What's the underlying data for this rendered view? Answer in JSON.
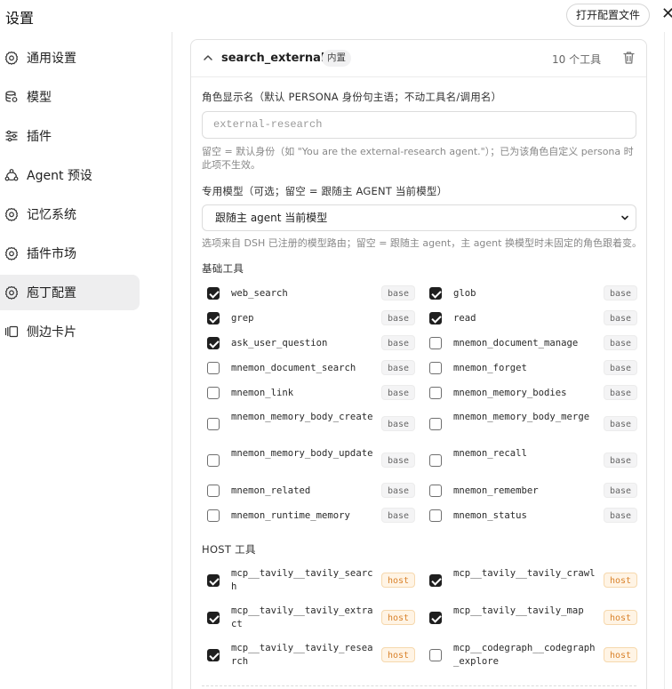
{
  "window": {
    "title": "设置",
    "open_config_label": "打开配置文件",
    "close_glyph": "✕"
  },
  "sidebar": {
    "items": [
      {
        "label": "通用设置",
        "icon": "gear-icon",
        "active": false
      },
      {
        "label": "模型",
        "icon": "model-icon",
        "active": false
      },
      {
        "label": "插件",
        "icon": "sliders-icon",
        "active": false
      },
      {
        "label": "Agent 预设",
        "icon": "agent-icon",
        "active": false
      },
      {
        "label": "记忆系统",
        "icon": "gear-icon",
        "active": false
      },
      {
        "label": "插件市场",
        "icon": "gear-icon",
        "active": false
      },
      {
        "label": "庖丁配置",
        "icon": "gear-icon",
        "active": true
      },
      {
        "label": "侧边卡片",
        "icon": "cards-icon",
        "active": false
      }
    ]
  },
  "agent": {
    "name": "search_external",
    "badge": "内置",
    "tool_count": "10 个工具",
    "persona_label": "角色显示名（默认 PERSONA 身份句主语；不动工具名/调用名）",
    "persona_placeholder": "external-research",
    "persona_hint": "留空 = 默认身份（如 \"You are the external-research agent.\"）；已为该角色自定义 persona 时此项不生效。",
    "model_label": "专用模型（可选；留空 = 跟随主 AGENT 当前模型）",
    "model_selected": "跟随主 agent 当前模型",
    "model_hint": "选项来自 DSH 已注册的模型路由；留空 = 跟随主 agent，主 agent 换模型时未固定的角色跟着变。",
    "base_tools_title": "基础工具",
    "host_tools_title": "HOST 工具",
    "base_tools": [
      {
        "name": "web_search",
        "checked": true,
        "tag": "base"
      },
      {
        "name": "glob",
        "checked": true,
        "tag": "base"
      },
      {
        "name": "grep",
        "checked": true,
        "tag": "base"
      },
      {
        "name": "read",
        "checked": true,
        "tag": "base"
      },
      {
        "name": "ask_user_question",
        "checked": true,
        "tag": "base"
      },
      {
        "name": "mnemon_document_manage",
        "checked": false,
        "tag": "base"
      },
      {
        "name": "mnemon_document_search",
        "checked": false,
        "tag": "base"
      },
      {
        "name": "mnemon_forget",
        "checked": false,
        "tag": "base"
      },
      {
        "name": "mnemon_link",
        "checked": false,
        "tag": "base"
      },
      {
        "name": "mnemon_memory_bodies",
        "checked": false,
        "tag": "base"
      },
      {
        "name": "mnemon_memory_body_create",
        "checked": false,
        "tag": "base"
      },
      {
        "name": "mnemon_memory_body_merge",
        "checked": false,
        "tag": "base"
      },
      {
        "name": "mnemon_memory_body_update",
        "checked": false,
        "tag": "base"
      },
      {
        "name": "mnemon_recall",
        "checked": false,
        "tag": "base"
      },
      {
        "name": "mnemon_related",
        "checked": false,
        "tag": "base"
      },
      {
        "name": "mnemon_remember",
        "checked": false,
        "tag": "base"
      },
      {
        "name": "mnemon_runtime_memory",
        "checked": false,
        "tag": "base"
      },
      {
        "name": "mnemon_status",
        "checked": false,
        "tag": "base"
      }
    ],
    "host_tools": [
      {
        "name": "mcp__tavily__tavily_search",
        "checked": true,
        "tag": "host"
      },
      {
        "name": "mcp__tavily__tavily_crawl",
        "checked": true,
        "tag": "host"
      },
      {
        "name": "mcp__tavily__tavily_extract",
        "checked": true,
        "tag": "host"
      },
      {
        "name": "mcp__tavily__tavily_map",
        "checked": true,
        "tag": "host"
      },
      {
        "name": "mcp__tavily__tavily_research",
        "checked": true,
        "tag": "host"
      },
      {
        "name": "mcp__codegraph__codegraph_explore",
        "checked": false,
        "tag": "host"
      }
    ]
  }
}
